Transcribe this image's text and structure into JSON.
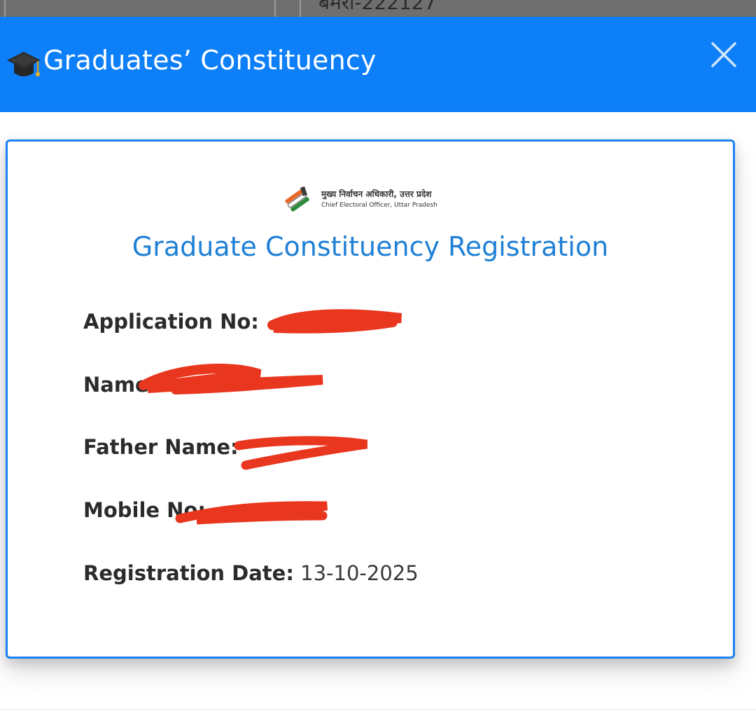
{
  "background": {
    "partial_text": "बमरा-222127"
  },
  "modal": {
    "header": {
      "icon": "graduation-cap-icon",
      "title": "Graduates’ Constituency",
      "close_icon": "close-icon",
      "background_color": "#0d7ff8"
    },
    "card": {
      "logo": {
        "hindi": "मुख्य निर्वाचन अधिकारी, उत्तर प्रदेश",
        "english": "Chief Electoral Officer, Uttar Pradesh"
      },
      "title": "Graduate Constituency Registration",
      "title_color": "#1f80d6",
      "border_color": "#1a82f0",
      "fields": [
        {
          "label": "Application No:",
          "value": ""
        },
        {
          "label": "Name:",
          "value": ""
        },
        {
          "label": "Father Name:",
          "value": ""
        },
        {
          "label": "Mobile No:",
          "value": ""
        },
        {
          "label": "Registration Date:",
          "value": "13-10-2025"
        }
      ]
    }
  },
  "redaction_color": "#e8361f"
}
